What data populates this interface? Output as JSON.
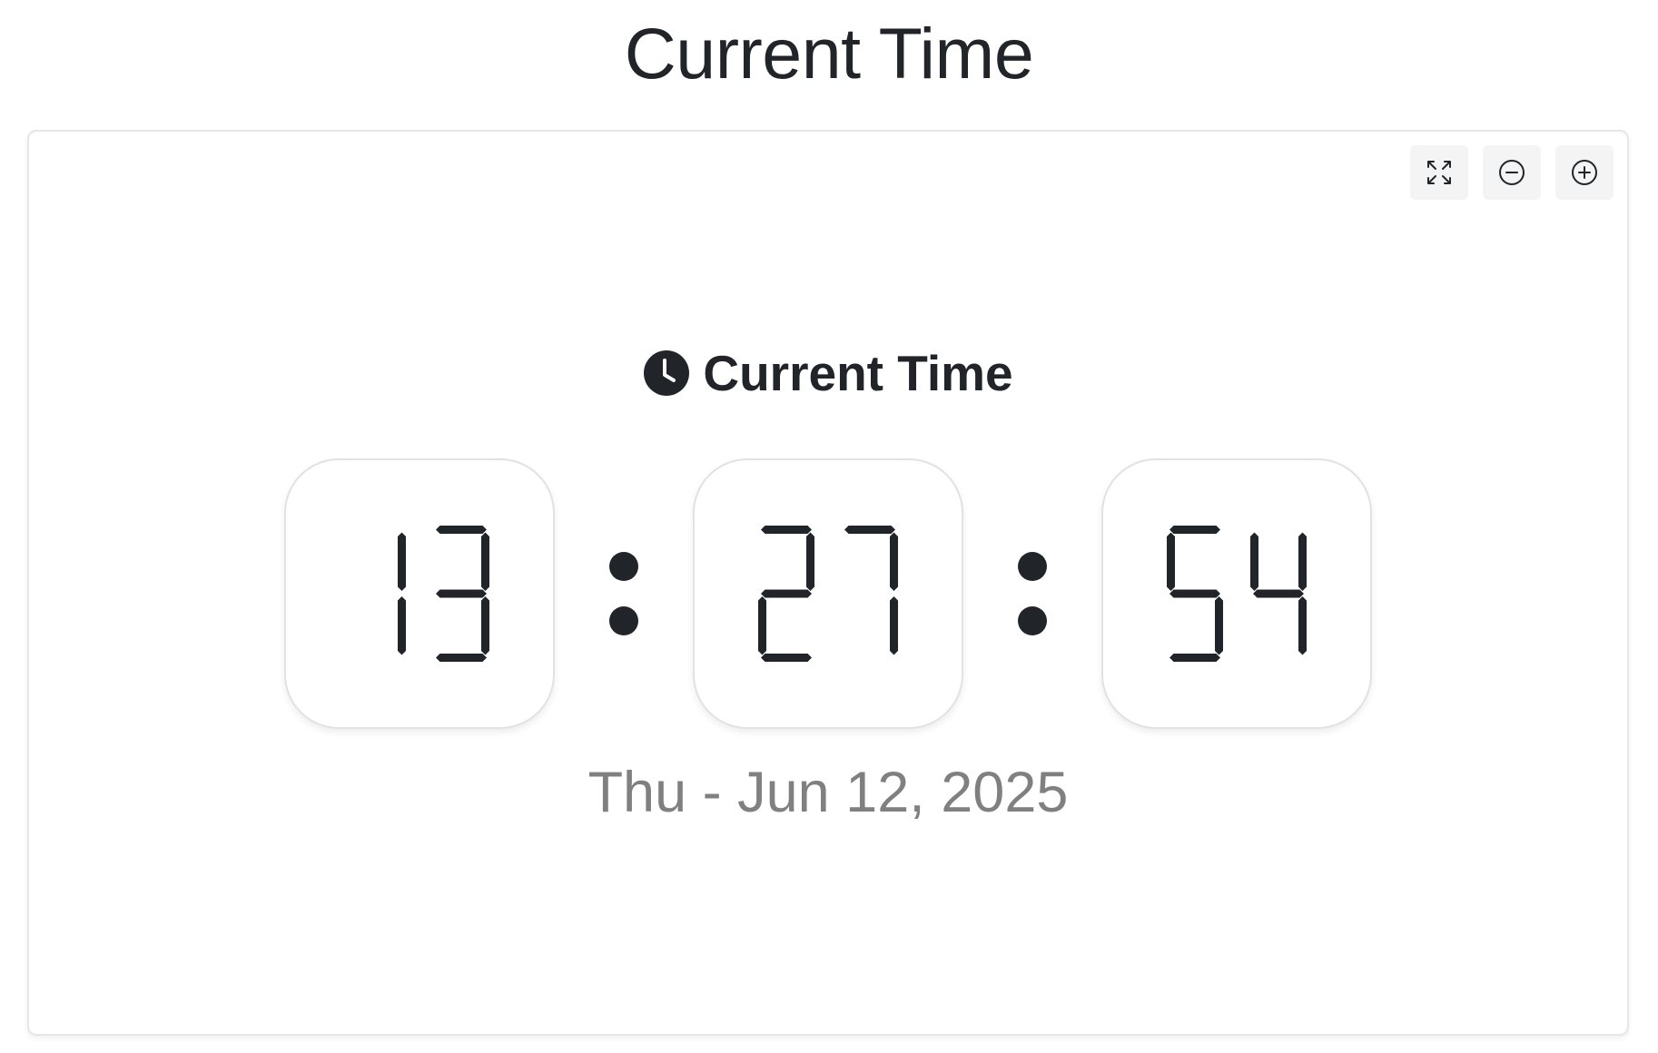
{
  "page": {
    "title": "Current Time"
  },
  "toolbar": {
    "buttons": [
      {
        "name": "fullscreen",
        "icon": "expand-icon"
      },
      {
        "name": "zoom-out",
        "icon": "minus-circle-icon"
      },
      {
        "name": "zoom-in",
        "icon": "plus-circle-icon"
      }
    ]
  },
  "clock": {
    "heading": "Current Time",
    "heading_icon": "clock-icon",
    "hours": "13",
    "minutes": "27",
    "seconds": "54",
    "separator": ":",
    "date": "Thu - Jun 12, 2025"
  },
  "colors": {
    "text": "#212529",
    "muted_text": "#808080",
    "digit": "#212529",
    "border": "#e6e6e6",
    "button_bg": "#f4f4f4"
  }
}
